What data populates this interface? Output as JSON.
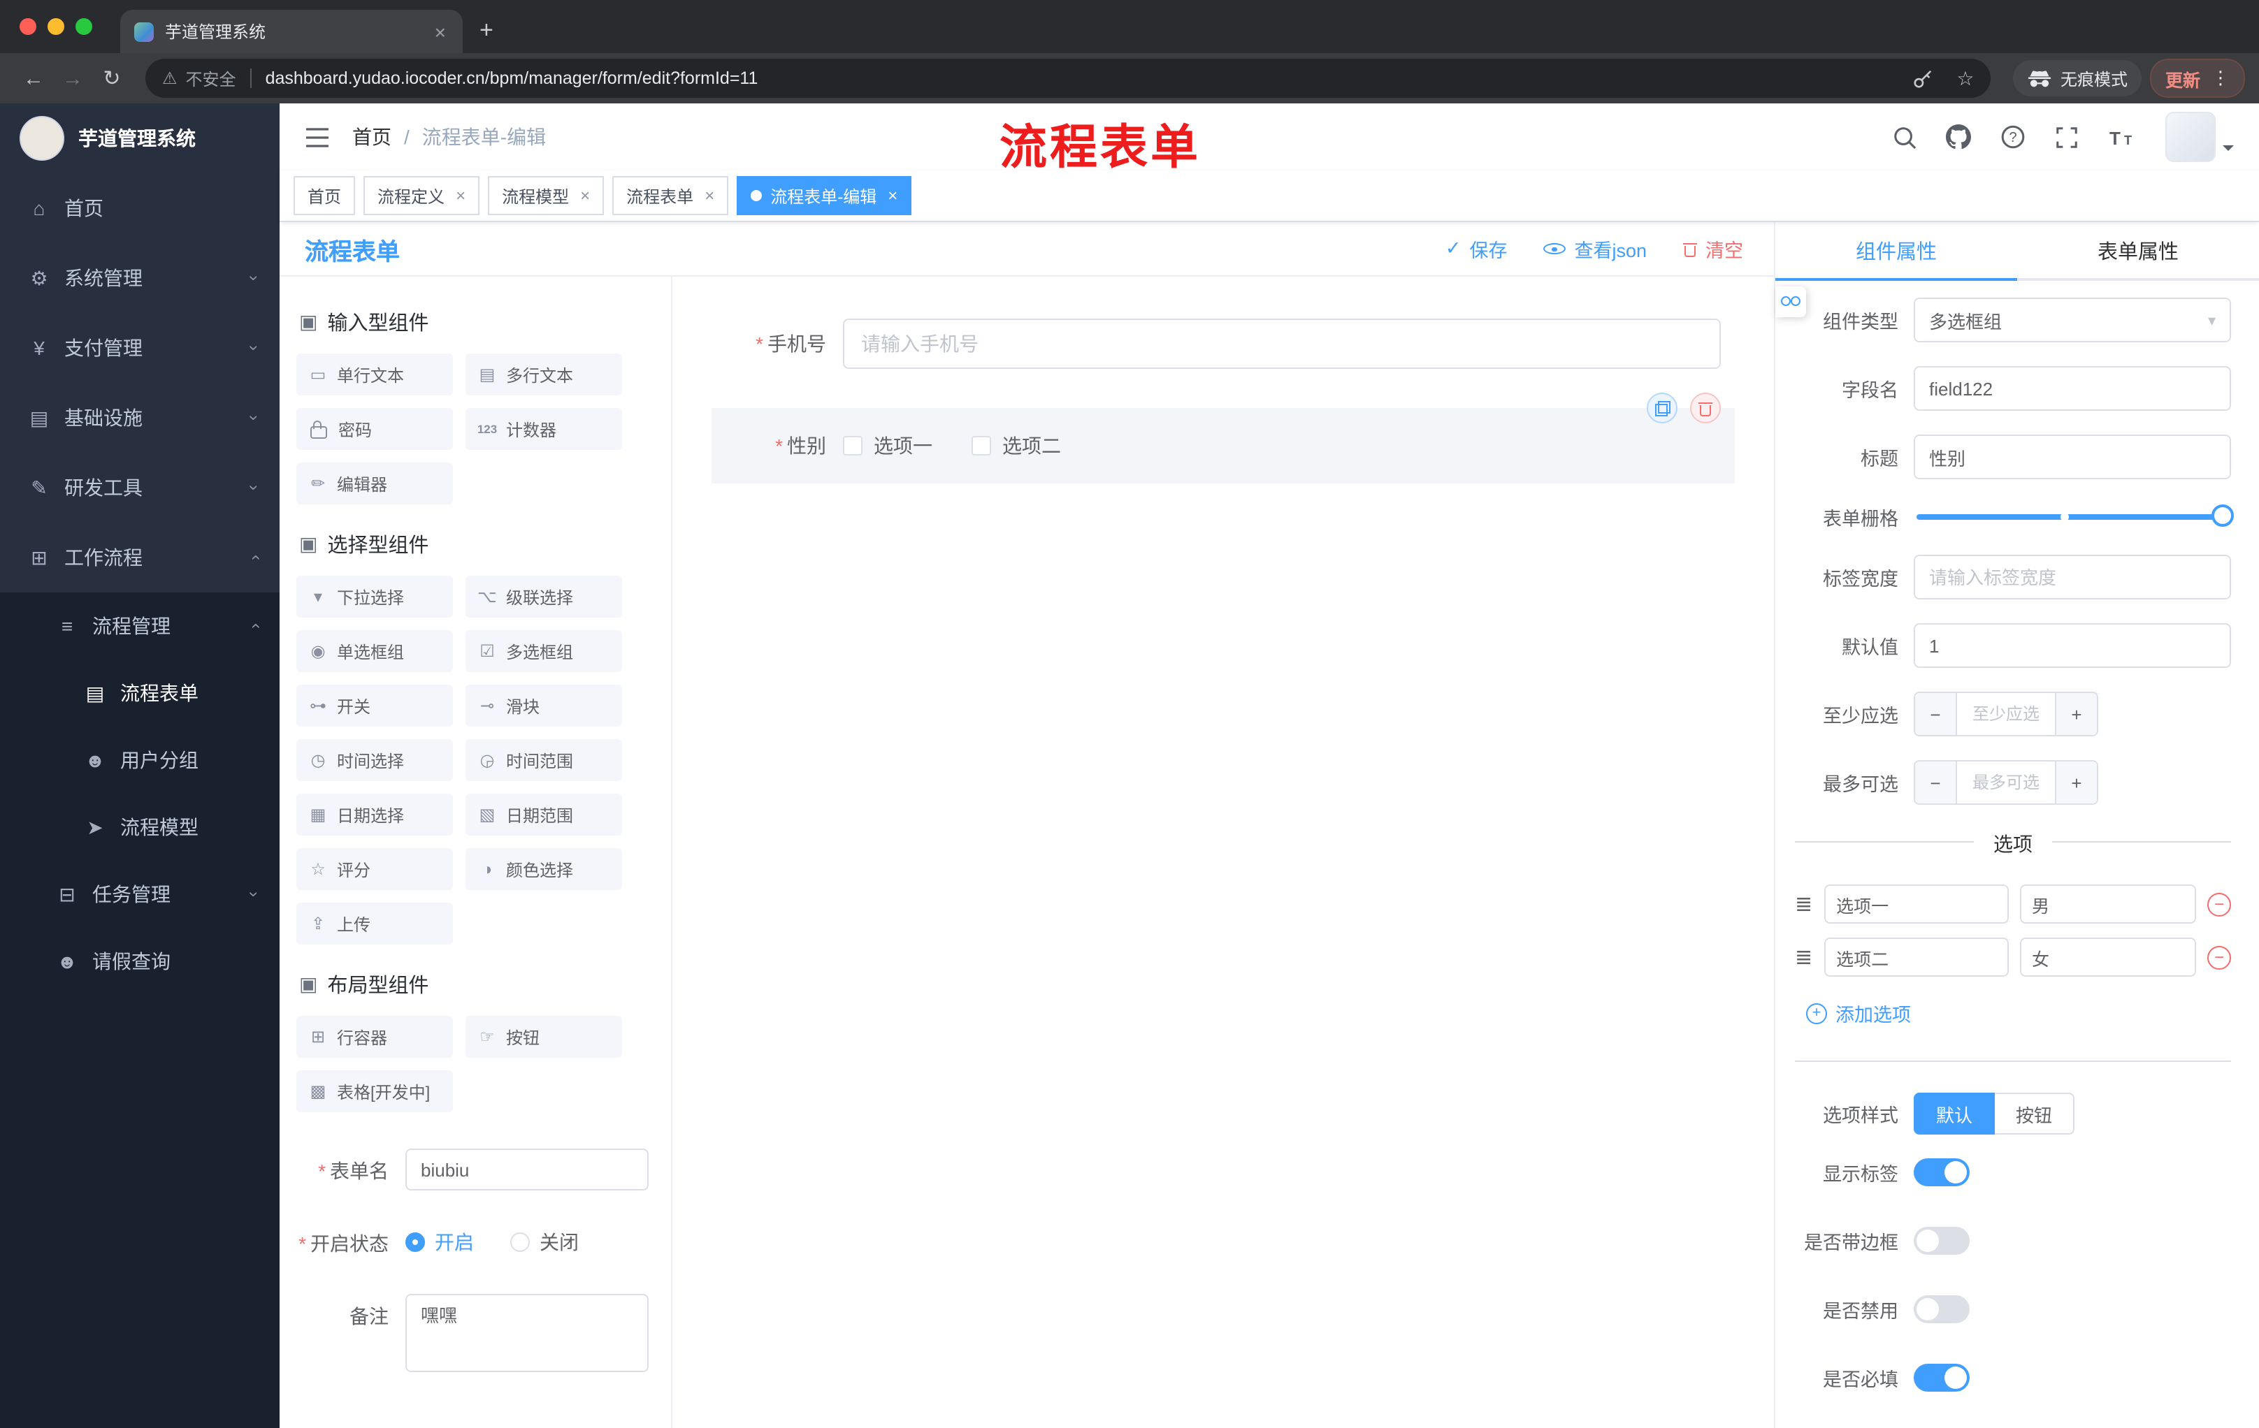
{
  "colors": {
    "accent": "#409EFF",
    "danger": "#F56C6C",
    "annotation_red": "#EE1D1D",
    "sidebar_bg": "#28303F",
    "active_tag_bg": "#409EFF"
  },
  "icons": {
    "tab_close": "×",
    "new_tab": "+",
    "back": "←",
    "forward": "→",
    "reload": "↻",
    "warning": "⚠",
    "star": "☆",
    "menu_dots": "⋮",
    "chevron": "›",
    "caret": "▾",
    "breadcrumb_sep": "/",
    "section": "▣",
    "check": "✓",
    "drag": "≣",
    "minus": "−",
    "plus": "+",
    "required": "*",
    "home": "⌂",
    "system": "⚙",
    "payment": "¥",
    "infra": "▤",
    "devtools": "✎",
    "workflow": "⊞",
    "process": "≡",
    "form": "▤",
    "users": "☻",
    "model": "➤",
    "task": "⊟",
    "person": "☻",
    "single_line": "▭",
    "multi_line": "▤",
    "counter": "123",
    "editor": "✏",
    "select": "▾",
    "cascader": "⌥",
    "radio": "◉",
    "checkbox": "☑",
    "switch": "⊶",
    "slider": "⊸",
    "time": "◷",
    "time_range": "◶",
    "date": "▦",
    "date_range": "▧",
    "rate": "☆",
    "color": "◑",
    "upload": "⇪",
    "row": "⊞",
    "button": "☞",
    "table": "▩"
  },
  "browser": {
    "tab_title": "芋道管理系统",
    "security_label": "不安全",
    "url": "dashboard.yudao.iocoder.cn/bpm/manager/form/edit?formId=11",
    "incognito_label": "无痕模式",
    "update_label": "更新"
  },
  "sidebar": {
    "logo_title": "芋道管理系统",
    "items": [
      {
        "label": "首页"
      },
      {
        "label": "系统管理"
      },
      {
        "label": "支付管理"
      },
      {
        "label": "基础设施"
      },
      {
        "label": "研发工具"
      },
      {
        "label": "工作流程"
      },
      {
        "label": "流程管理"
      },
      {
        "label": "流程表单"
      },
      {
        "label": "用户分组"
      },
      {
        "label": "流程模型"
      },
      {
        "label": "任务管理"
      },
      {
        "label": "请假查询"
      }
    ]
  },
  "header": {
    "breadcrumb": [
      "首页",
      "流程表单-编辑"
    ],
    "annotation": "流程表单"
  },
  "tags": [
    {
      "label": "首页"
    },
    {
      "label": "流程定义"
    },
    {
      "label": "流程模型"
    },
    {
      "label": "流程表单"
    },
    {
      "label": "流程表单-编辑"
    }
  ],
  "builder": {
    "title": "流程表单",
    "actions": {
      "save": "保存",
      "view_json": "查看json",
      "clear": "清空"
    },
    "groups": [
      {
        "title": "输入型组件",
        "items": [
          "单行文本",
          "多行文本",
          "密码",
          "计数器",
          "编辑器"
        ]
      },
      {
        "title": "选择型组件",
        "items": [
          "下拉选择",
          "级联选择",
          "单选框组",
          "多选框组",
          "开关",
          "滑块",
          "时间选择",
          "时间范围",
          "日期选择",
          "日期范围",
          "评分",
          "颜色选择",
          "上传"
        ]
      },
      {
        "title": "布局型组件",
        "items": [
          "行容器",
          "按钮",
          "表格[开发中]"
        ]
      }
    ],
    "meta": {
      "name_label": "表单名",
      "name_value": "biubiu",
      "status_label": "开启状态",
      "status_on": "开启",
      "status_off": "关闭",
      "remark_label": "备注",
      "remark_value": "嘿嘿"
    },
    "canvas": {
      "phone_label": "手机号",
      "phone_placeholder": "请输入手机号",
      "gender_label": "性别",
      "gender_options": [
        "选项一",
        "选项二"
      ]
    }
  },
  "props": {
    "tab_component": "组件属性",
    "tab_form": "表单属性",
    "rows": {
      "type_label": "组件类型",
      "type_value": "多选框组",
      "field_label": "字段名",
      "field_value": "field122",
      "title_label": "标题",
      "title_value": "性别",
      "grid_label": "表单栅格",
      "width_label": "标签宽度",
      "width_placeholder": "请输入标签宽度",
      "default_label": "默认值",
      "default_value": "1",
      "min_label": "至少应选",
      "min_placeholder": "至少应选",
      "max_label": "最多可选",
      "max_placeholder": "最多可选"
    },
    "options": {
      "divider": "选项",
      "rows": [
        {
          "label": "选项一",
          "value": "男"
        },
        {
          "label": "选项二",
          "value": "女"
        }
      ],
      "add": "添加选项"
    },
    "style": {
      "label": "选项样式",
      "option_default": "默认",
      "option_button": "按钮",
      "toggles": [
        {
          "label": "显示标签",
          "on": true
        },
        {
          "label": "是否带边框",
          "on": false
        },
        {
          "label": "是否禁用",
          "on": false
        },
        {
          "label": "是否必填",
          "on": true
        }
      ]
    }
  }
}
